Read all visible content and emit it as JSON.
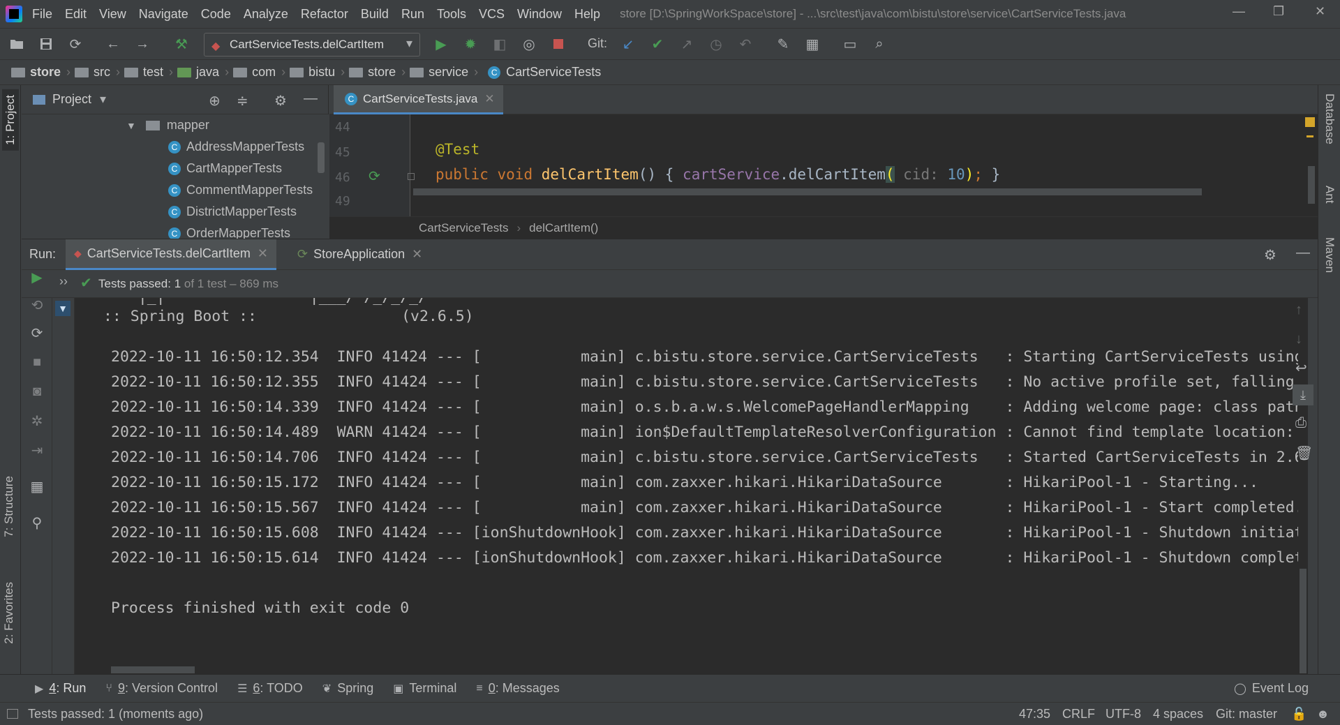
{
  "menu": {
    "items": [
      "File",
      "Edit",
      "View",
      "Navigate",
      "Code",
      "Analyze",
      "Refactor",
      "Build",
      "Run",
      "Tools",
      "VCS",
      "Window",
      "Help"
    ],
    "title": "store [D:\\SpringWorkSpace\\store] - ...\\src\\test\\java\\com\\bistu\\store\\service\\CartServiceTests.java",
    "window_controls": [
      "—",
      "❐",
      "✕"
    ]
  },
  "toolbar": {
    "run_config": "CartServiceTests.delCartItem",
    "git_label": "Git:"
  },
  "breadcrumb": [
    "store",
    "src",
    "test",
    "java",
    "com",
    "bistu",
    "store",
    "service",
    "CartServiceTests"
  ],
  "left_stripe": {
    "project": "1: Project",
    "structure": "7: Structure",
    "favorites": "2: Favorites"
  },
  "right_stripe": {
    "database": "Database",
    "ant": "Ant",
    "maven": "Maven"
  },
  "project_panel": {
    "title": "Project",
    "tree": [
      {
        "label": "mapper",
        "kind": "folder",
        "depth": 0
      },
      {
        "label": "AddressMapperTests",
        "kind": "class",
        "depth": 1
      },
      {
        "label": "CartMapperTests",
        "kind": "class",
        "depth": 1
      },
      {
        "label": "CommentMapperTests",
        "kind": "class",
        "depth": 1
      },
      {
        "label": "DistrictMapperTests",
        "kind": "class",
        "depth": 1
      },
      {
        "label": "OrderMapperTests",
        "kind": "class",
        "depth": 1
      }
    ]
  },
  "editor": {
    "tab": "CartServiceTests.java",
    "line_numbers": [
      "44",
      "45",
      "46",
      "49"
    ],
    "code": {
      "annotation": "@Test",
      "kw_public": "public",
      "kw_void": "void",
      "method": "delCartItem",
      "parens_open": "() { ",
      "field": "cartService",
      "dot": ".",
      "call": "delCartItem",
      "paren": "(",
      "hint": " cid: ",
      "arg": "10",
      "close_paren": ")",
      "semi": ";",
      "tail": " }"
    },
    "crumbs": [
      "CartServiceTests",
      "delCartItem()"
    ]
  },
  "run": {
    "label": "Run:",
    "tabs": [
      "CartServiceTests.delCartItem",
      "StoreApplication"
    ],
    "status_prefix": "Tests passed:",
    "status_count": "1",
    "status_suffix": "of 1 test – 869 ms",
    "console": [
      "   |_|                |___/ /_/_/_/",
      " :: Spring Boot ::                (v2.6.5)",
      "",
      "2022-10-11 16:50:12.354  INFO 41424 --- [           main] c.bistu.store.service.CartServiceTests   : Starting CartServiceTests using",
      "2022-10-11 16:50:12.355  INFO 41424 --- [           main] c.bistu.store.service.CartServiceTests   : No active profile set, falling",
      "2022-10-11 16:50:14.339  INFO 41424 --- [           main] o.s.b.a.w.s.WelcomePageHandlerMapping    : Adding welcome page: class path",
      "2022-10-11 16:50:14.489  WARN 41424 --- [           main] ion$DefaultTemplateResolverConfiguration : Cannot find template location:",
      "2022-10-11 16:50:14.706  INFO 41424 --- [           main] c.bistu.store.service.CartServiceTests   : Started CartServiceTests in 2.6",
      "2022-10-11 16:50:15.172  INFO 41424 --- [           main] com.zaxxer.hikari.HikariDataSource       : HikariPool-1 - Starting...",
      "2022-10-11 16:50:15.567  INFO 41424 --- [           main] com.zaxxer.hikari.HikariDataSource       : HikariPool-1 - Start completed.",
      "2022-10-11 16:50:15.608  INFO 41424 --- [ionShutdownHook] com.zaxxer.hikari.HikariDataSource       : HikariPool-1 - Shutdown initiat",
      "2022-10-11 16:50:15.614  INFO 41424 --- [ionShutdownHook] com.zaxxer.hikari.HikariDataSource       : HikariPool-1 - Shutdown complet",
      "",
      "Process finished with exit code 0"
    ]
  },
  "bottom_bar": {
    "items": [
      {
        "num": "4",
        "label": ": Run"
      },
      {
        "num": "9",
        "label": ": Version Control"
      },
      {
        "num": "6",
        "label": ": TODO"
      },
      {
        "num": "",
        "label": "Spring"
      },
      {
        "num": "",
        "label": "Terminal"
      },
      {
        "num": "0",
        "label": ": Messages"
      }
    ],
    "event_log": "Event Log"
  },
  "status_bar": {
    "message": "Tests passed: 1 (moments ago)",
    "position": "47:35",
    "line_sep": "CRLF",
    "encoding": "UTF-8",
    "indent": "4 spaces",
    "git": "Git: master"
  },
  "colors": {
    "accent_blue": "#4a88c7",
    "run_green": "#499c54",
    "stop_red": "#c75450",
    "keyword": "#cc7832",
    "method": "#ffc66d",
    "annotation": "#bbb529",
    "field": "#9876aa",
    "number": "#6897bb"
  }
}
